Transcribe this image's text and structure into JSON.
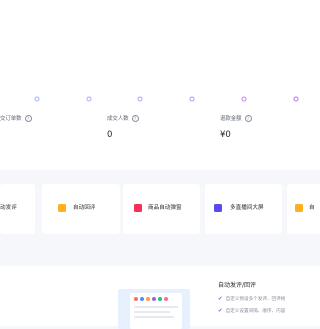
{
  "stats": [
    {
      "label": "交订单数",
      "help_icon": "question-circle-icon",
      "value": ""
    },
    {
      "label": "成交人数",
      "help_icon": "question-circle-icon",
      "value": "0"
    },
    {
      "label": "退款金额",
      "help_icon": "question-circle-icon",
      "value": "¥0"
    }
  ],
  "tools": [
    {
      "label": "动发评",
      "icon": "none"
    },
    {
      "label": "自动回评",
      "icon": "comment-icon",
      "color": "#ffb020"
    },
    {
      "label": "商品自动弹窗",
      "icon": "popup-icon",
      "color": "#f5315a"
    },
    {
      "label": "多直播间大屏",
      "icon": "play-screen-icon",
      "color": "#5a4bf0"
    },
    {
      "label": "自",
      "icon": "comment-icon",
      "color": "#ffb020"
    }
  ],
  "feature_panel": {
    "title": "自动发评/回评",
    "items": [
      "自定义预设多个发评、回评格",
      "自定义设置间隔、顺序、内容"
    ]
  },
  "colors": {
    "line_start": "#8fb3ff",
    "line_end": "#c46cf0",
    "background": "#f5f7fb",
    "check": "#5b7cf7"
  }
}
